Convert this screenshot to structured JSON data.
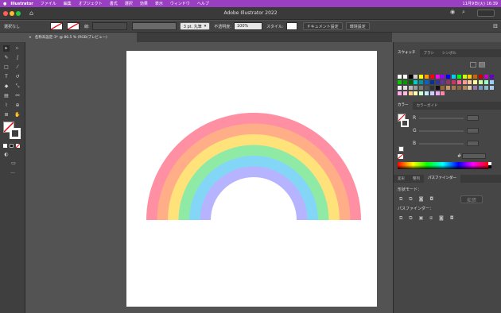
{
  "menubar": {
    "items": [
      "Illustrator",
      "ファイル",
      "編集",
      "オブジェクト",
      "書式",
      "選択",
      "効果",
      "表示",
      "ウィンドウ",
      "ヘルプ"
    ],
    "clock": "11月9日(火) 16:39"
  },
  "titlebar": {
    "title": "Adobe Illustrator 2022"
  },
  "control": {
    "selection": "選択なし",
    "stroke_label": "線:",
    "brush": "3 pt. 丸筆",
    "opacity_label": "不透明度:",
    "opacity_value": "100%",
    "style_label": "スタイル:",
    "doc_setup": "ドキュメント設定",
    "prefs": "環境設定"
  },
  "tab": {
    "label": "名称未設定-3* @ 86.5 % (RGB/プレビュー)"
  },
  "rainbow": {
    "colors": [
      "#ff8fa3",
      "#ffae88",
      "#ffe27a",
      "#8feaa6",
      "#84d6f6",
      "#b7b4ff"
    ]
  },
  "panels": {
    "swatch_tabs": [
      "スウォッチ",
      "ブラシ",
      "シンボル"
    ],
    "color_tabs": [
      "カラー",
      "カラーガイド"
    ],
    "color": {
      "r": "R",
      "g": "G",
      "b": "B",
      "hash": "#"
    },
    "bottom_tabs": [
      "変形",
      "整列",
      "パスファインダー"
    ],
    "shape_modes": "形状モード：",
    "expand": "拡張",
    "pathfinder": "パスファインダー："
  }
}
